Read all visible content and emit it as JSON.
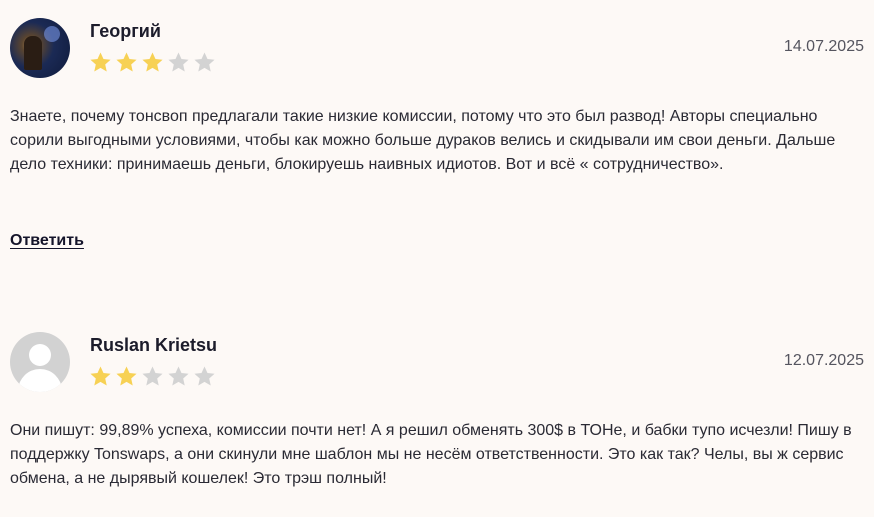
{
  "colors": {
    "background": "#fdf9f6",
    "star_filled": "#f7d154",
    "star_empty": "#d3d3d3",
    "text": "#2a2a34"
  },
  "reviews": [
    {
      "author": "Георгий",
      "avatar": "photo-avatar",
      "rating": 3,
      "rating_max": 5,
      "date": "14.07.2025",
      "text": "Знаете, почему тонсвоп предлагали такие низкие комиссии, потому что это был развод! Авторы специально сорили выгодными условиями, чтобы как можно больше дураков велись и скидывали им свои деньги. Дальше дело техники: принимаешь деньги, блокируешь наивных идиотов. Вот и всё « сотрудничество».",
      "reply_label": "Ответить"
    },
    {
      "author": "Ruslan Krietsu",
      "avatar": "default-user-avatar",
      "rating": 2,
      "rating_max": 5,
      "date": "12.07.2025",
      "text": "Они пишут: 99,89% успеха, комиссии почти нет! А я решил обменять 300$ в ТОНе, и бабки тупо исчезли! Пишу в поддержку Tonswaps, а они скинули мне шаблон мы не несём ответственности. Это как так? Челы, вы ж сервис обмена, а не дырявый кошелек! Это трэш полный!"
    }
  ]
}
